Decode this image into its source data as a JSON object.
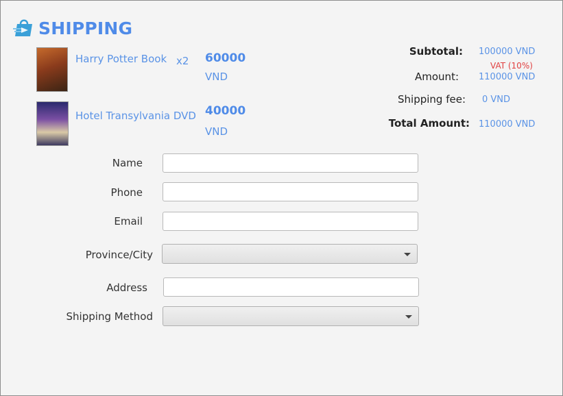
{
  "header": {
    "title": "SHIPPING",
    "logo_icon": "shopping-bag-icon"
  },
  "cart": {
    "items": [
      {
        "name": "Harry Potter Book",
        "quantity": "x2",
        "price": "60000",
        "currency": "VND"
      },
      {
        "name": "Hotel Transylvania DVD",
        "quantity": "",
        "price": "40000",
        "currency": "VND"
      }
    ]
  },
  "summary": {
    "subtotal_label": "Subtotal:",
    "subtotal_value": "100000 VND",
    "vat_note": "VAT (10%)",
    "amount_label": "Amount:",
    "amount_value": "110000 VND",
    "shipping_fee_label": "Shipping fee:",
    "shipping_fee_value": "0 VND",
    "total_label": "Total Amount:",
    "total_value": "110000 VND"
  },
  "form": {
    "name_label": "Name",
    "name_value": "",
    "phone_label": "Phone",
    "phone_value": "",
    "email_label": "Email",
    "email_value": "",
    "province_label": "Province/City",
    "province_value": "",
    "address_label": "Address",
    "address_value": "",
    "shipping_method_label": "Shipping Method",
    "shipping_method_value": ""
  },
  "colors": {
    "accent": "#4f8be8",
    "vat": "#e04040",
    "background": "#f4f4f4"
  }
}
